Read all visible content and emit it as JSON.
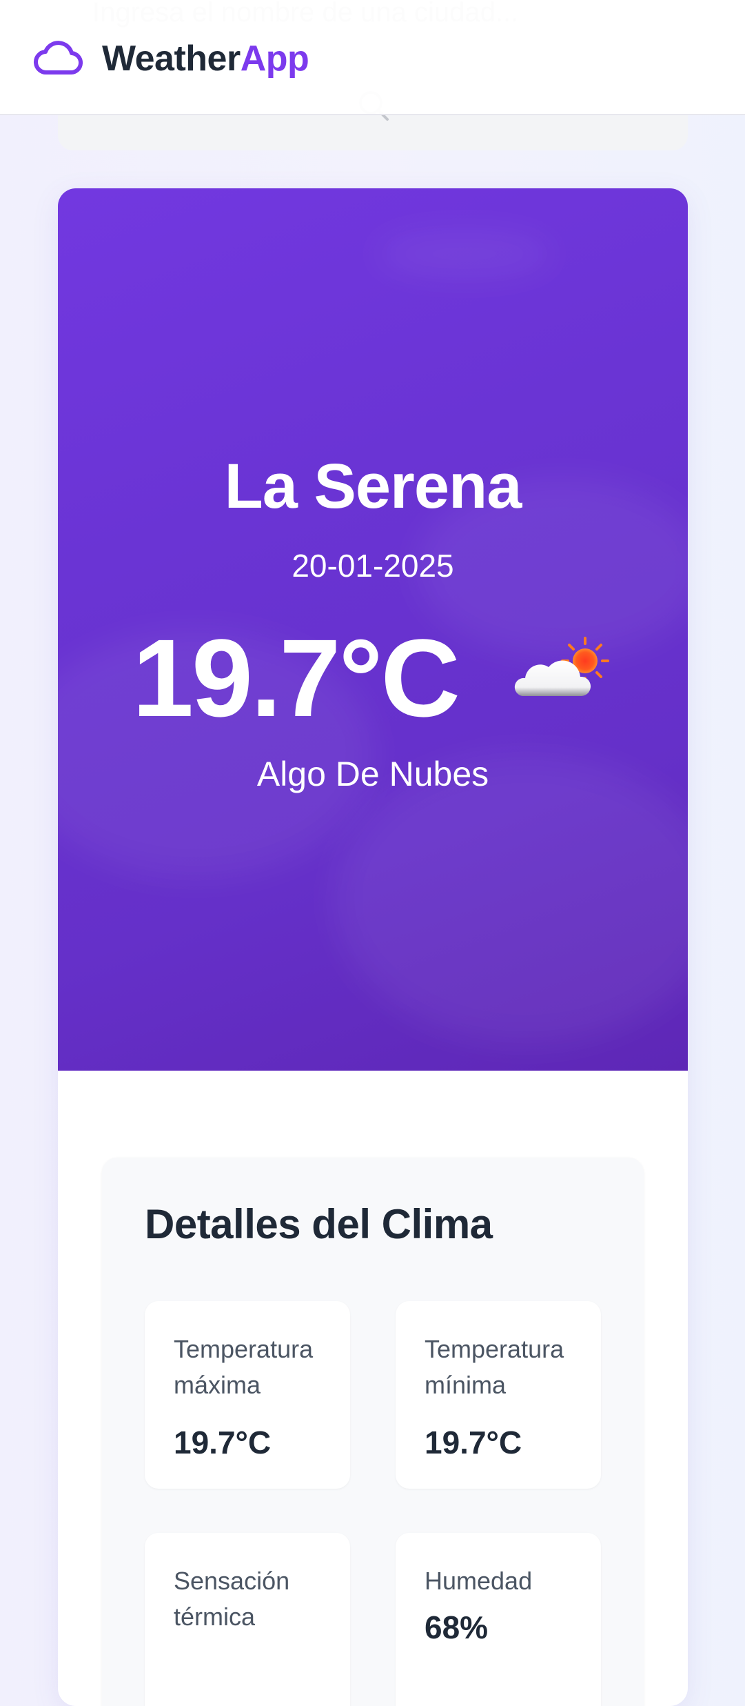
{
  "app": {
    "brand_part1": "Weather",
    "brand_part2": "App",
    "brand_color": "#7c3aed",
    "logo_icon": "cloud-icon"
  },
  "search": {
    "placeholder": "Ingresa el nombre de una ciudad...",
    "button_icon": "search-icon"
  },
  "current": {
    "city": "La Serena",
    "date": "20-01-2025",
    "temperature": "19.7°C",
    "description": "Algo De Nubes",
    "icon": "partly-cloudy-icon"
  },
  "details": {
    "title": "Detalles del Clima",
    "items": [
      {
        "label": "Temperatura máxima",
        "value": "19.7°C"
      },
      {
        "label": "Temperatura mínima",
        "value": "19.7°C"
      },
      {
        "label": "Sensación térmica",
        "value": ""
      },
      {
        "label": "Humedad",
        "value": "68%"
      }
    ]
  }
}
